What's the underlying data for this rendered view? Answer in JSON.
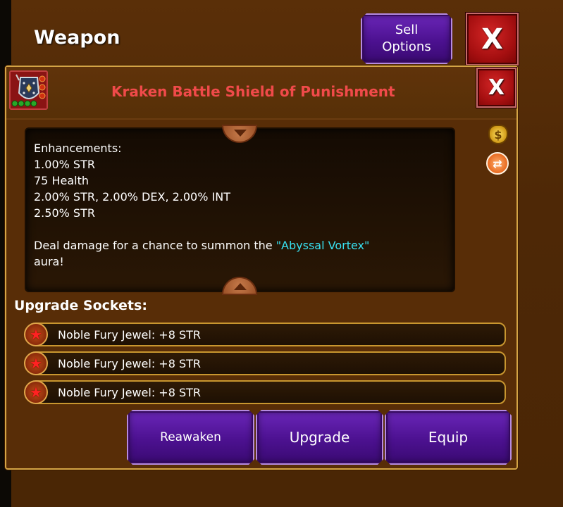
{
  "header": {
    "title": "Weapon",
    "sell_options_label": "Sell Options",
    "close_label": "X"
  },
  "item": {
    "name": "Kraken Battle Shield of Punishment",
    "close_label": "X",
    "gem_slots_filled": 4,
    "icon_gems_count": 3
  },
  "description": {
    "lines": [
      "Enhancements:",
      "1.00% STR",
      "75 Health",
      "2.00% STR, 2.00% DEX, 2.00% INT",
      "2.50% STR"
    ],
    "effect_prefix": "Deal damage for a chance to summon the ",
    "aura_name": "\"Abyssal Vortex\"",
    "effect_suffix": "aura!"
  },
  "sockets": {
    "label": "Upgrade Sockets:",
    "items": [
      {
        "text": "Noble Fury Jewel: +8 STR"
      },
      {
        "text": "Noble Fury Jewel: +8 STR"
      },
      {
        "text": "Noble Fury Jewel: +8 STR"
      }
    ]
  },
  "actions": {
    "reawaken_label": "Reawaken",
    "upgrade_label": "Upgrade",
    "equip_label": "Equip"
  },
  "colors": {
    "background": "#4a2605",
    "item_name": "#f04a4a",
    "aura_text": "#38e0f0",
    "button_purple": "#4c1190",
    "close_red": "#a50f10",
    "frame_gold": "#d4a445"
  },
  "icons": {
    "gold_bag": "gold-bag-icon",
    "swap": "swap-icon",
    "socket_gem": "red-star-gem-icon"
  }
}
